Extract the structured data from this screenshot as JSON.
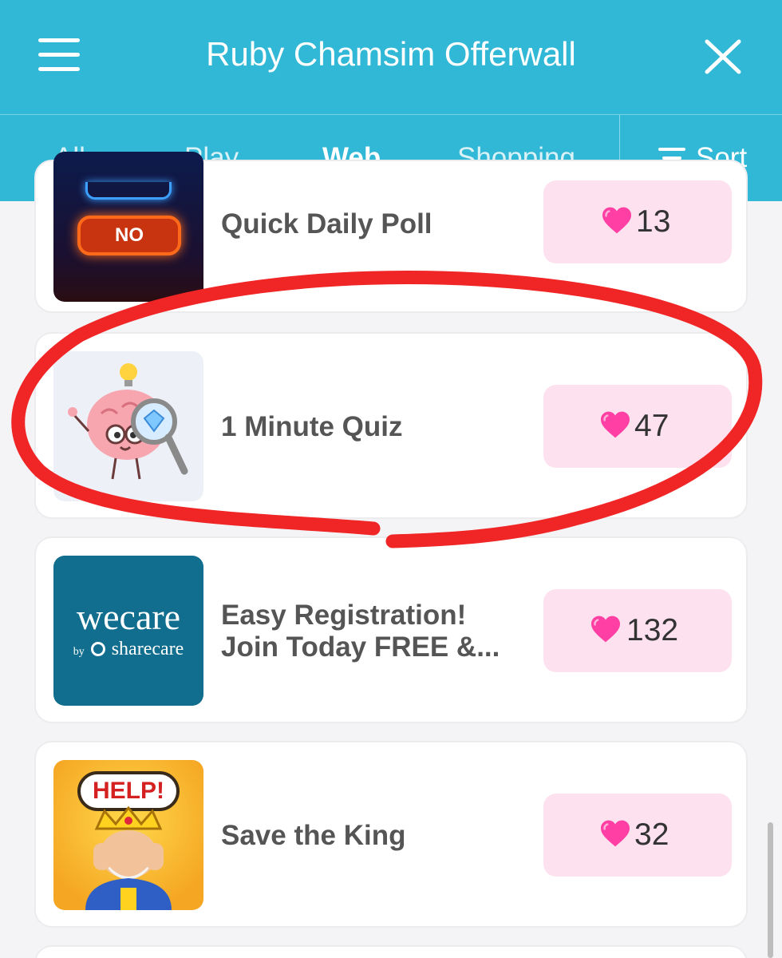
{
  "header": {
    "title": "Ruby Chamsim Offerwall",
    "menu_icon": "hamburger-icon",
    "close_icon": "close-icon"
  },
  "tabs": [
    {
      "label": "All",
      "active": false
    },
    {
      "label": "Play",
      "active": false
    },
    {
      "label": "Web",
      "active": true
    },
    {
      "label": "Shopping",
      "active": false
    }
  ],
  "sort": {
    "label": "Sort",
    "icon": "filter-sort-icon"
  },
  "offers": [
    {
      "title": "Quick Daily Poll",
      "reward": "13",
      "thumb_text": "NO",
      "thumb_icon": "yes-no-buttons-image"
    },
    {
      "title": "1 Minute Quiz",
      "reward": "47",
      "thumb_icon": "brain-magnifier-image",
      "highlighted": true
    },
    {
      "title_line1": "Easy Registration!",
      "title_line2": "Join Today FREE &...",
      "reward": "132",
      "thumb_logo": "wecare",
      "thumb_by": "by",
      "thumb_brand": "sharecare"
    },
    {
      "title": "Save the King",
      "reward": "32",
      "thumb_text": "HELP!",
      "thumb_icon": "crying-king-image"
    }
  ],
  "reward_icon": "heart-icon",
  "colors": {
    "header": "#30b8d6",
    "reward_bg": "#fde1ef",
    "heart": "#ff3fa4",
    "annotation": "#f02525"
  }
}
